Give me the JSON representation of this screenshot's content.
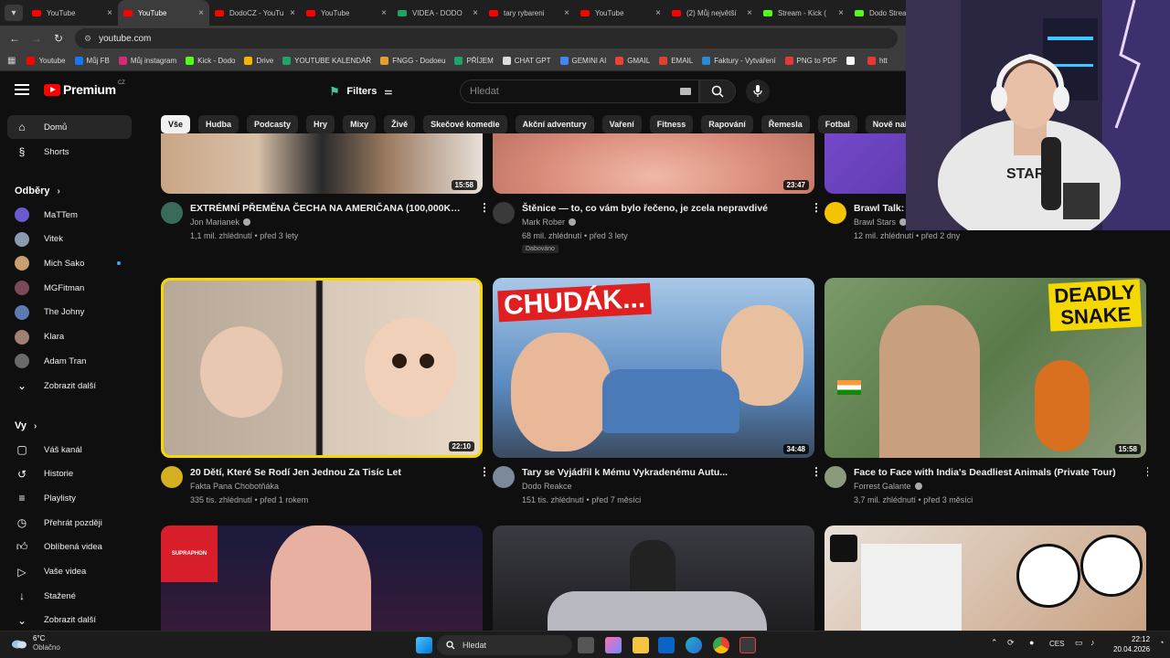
{
  "browser": {
    "tabs": [
      {
        "label": "YouTube",
        "active": false,
        "favicon_color": "#ff0000"
      },
      {
        "label": "YouTube",
        "active": true,
        "favicon_color": "#ff0000"
      },
      {
        "label": "DodoCZ - YouTu",
        "active": false,
        "favicon_color": "#ff0000"
      },
      {
        "label": "YouTube",
        "active": false,
        "favicon_color": "#ff0000"
      },
      {
        "label": "VIDEA - DODO",
        "active": false,
        "favicon_color": "#1fa463"
      },
      {
        "label": "tary rybareni",
        "active": false,
        "favicon_color": "#ff0000"
      },
      {
        "label": "YouTube",
        "active": false,
        "favicon_color": "#ff0000"
      },
      {
        "label": "(2) Můj největší",
        "active": false,
        "favicon_color": "#ff0000"
      },
      {
        "label": "Stream - Kick (",
        "active": false,
        "favicon_color": "#53fc18"
      },
      {
        "label": "Dodo Strea",
        "active": false,
        "favicon_color": "#53fc18"
      }
    ],
    "url": "youtube.com",
    "bookmarks": [
      {
        "label": "Youtube",
        "color": "#ff0000"
      },
      {
        "label": "Můj FB",
        "color": "#1877f2"
      },
      {
        "label": "Můj instagram",
        "color": "#d62976"
      },
      {
        "label": "Kick - Dodo",
        "color": "#53fc18"
      },
      {
        "label": "Drive",
        "color": "#f4b400"
      },
      {
        "label": "YOUTUBE KALENDÁŘ",
        "color": "#1fa463"
      },
      {
        "label": "FNGG - Dodoeu",
        "color": "#e0a030"
      },
      {
        "label": "PŘÍJEM",
        "color": "#1fa463"
      },
      {
        "label": "CHAT GPT",
        "color": "#dddddd"
      },
      {
        "label": "GEMINI AI",
        "color": "#4285f4"
      },
      {
        "label": "GMAIL",
        "color": "#ea4335"
      },
      {
        "label": "EMAIL",
        "color": "#e04030"
      },
      {
        "label": "Faktury - Vytváření",
        "color": "#2a8ad4"
      },
      {
        "label": "PNG to PDF",
        "color": "#e53935"
      },
      {
        "label": "",
        "color": "#ffffff"
      },
      {
        "label": "htt",
        "color": "#e53935"
      }
    ]
  },
  "header": {
    "brand": "Premium",
    "region": "CZ",
    "filters_label": "Filters",
    "search_placeholder": "Hledat"
  },
  "chips": [
    "Vše",
    "Hudba",
    "Podcasty",
    "Hry",
    "Mixy",
    "Živě",
    "Skečové komedie",
    "Akční adventury",
    "Vaření",
    "Fitness",
    "Rapování",
    "Řemesla",
    "Fotbal",
    "Nově nahráno"
  ],
  "sidebar": {
    "main": [
      {
        "label": "Domů",
        "icon": "home-icon",
        "active": true
      },
      {
        "label": "Shorts",
        "icon": "shorts-icon",
        "active": false
      }
    ],
    "subscriptions_heading": "Odběry",
    "subscriptions": [
      {
        "label": "MaTTem",
        "color": "#6a5acd",
        "live": false
      },
      {
        "label": "Vitek",
        "color": "#8a9bb0",
        "live": false
      },
      {
        "label": "Mich Sako",
        "color": "#c8a070",
        "live": true
      },
      {
        "label": "MGFitman",
        "color": "#7a4a5a",
        "live": false
      },
      {
        "label": "The Johny",
        "color": "#5a7ab0",
        "live": false
      },
      {
        "label": "Klara",
        "color": "#a08070",
        "live": false
      },
      {
        "label": "Adam Tran",
        "color": "#6a6a6a",
        "live": false
      }
    ],
    "show_more": "Zobrazit další",
    "you_heading": "Vy",
    "you_items": [
      {
        "label": "Váš kanál",
        "icon": "your-channel-icon"
      },
      {
        "label": "Historie",
        "icon": "history-icon"
      },
      {
        "label": "Playlisty",
        "icon": "playlists-icon"
      },
      {
        "label": "Přehrát později",
        "icon": "watch-later-icon"
      },
      {
        "label": "Oblíbená videa",
        "icon": "liked-videos-icon"
      },
      {
        "label": "Vaše videa",
        "icon": "your-videos-icon"
      },
      {
        "label": "Stažené",
        "icon": "downloads-icon"
      },
      {
        "label": "Zobrazit další",
        "icon": "chevron-down-icon"
      }
    ]
  },
  "videos_row1": [
    {
      "title": "EXTRÉMNÍ PŘEMĚNA ČECHA NA AMERIČANA (100,000Kč+)",
      "channel": "Jon Marianek",
      "verified": true,
      "stats": "1,1 mil. zhlédnutí • před 3 lety",
      "duration": "15:58",
      "badge": "",
      "thumb_color": "#c9a586",
      "avatar_color": "#3a6a5a"
    },
    {
      "title": "Štěnice — to, co vám bylo řečeno, je zcela nepravdivé",
      "channel": "Mark Rober",
      "verified": true,
      "stats": "68 mil. zhlédnutí • před 3 lety",
      "duration": "23:47",
      "badge": "Dabováno",
      "thumb_color": "#d98b7a",
      "avatar_color": "#3a3a3a"
    },
    {
      "title": "Brawl Talk: 3",
      "channel": "Brawl Stars",
      "verified": true,
      "stats": "12 mil. zhlédnutí • před 2 dny",
      "duration": "",
      "badge": "",
      "thumb_color": "#5a3aa0",
      "avatar_color": "#f5c400"
    }
  ],
  "videos_row2": [
    {
      "title": "20 Dětí, Které Se Rodí Jen Jednou Za Tisíc Let",
      "channel": "Fakta Pana Chobotňáka",
      "verified": false,
      "stats": "335 tis. zhlédnutí • před 1 rokem",
      "duration": "22:10",
      "badge": "",
      "thumb_color": "#b8a898",
      "avatar_color": "#d4b020"
    },
    {
      "title": "Tary se Vyjádřil k Mému Vykradenému Autu...",
      "channel": "Dodo Reakce",
      "verified": false,
      "stats": "151 tis. zhlédnutí • před 7 měsíci",
      "duration": "34:48",
      "badge": "",
      "thumb_color": "#6a8ab0",
      "avatar_color": "#7a8a9a"
    },
    {
      "title": "Face to Face with India's Deadliest Animals (Private Tour)",
      "channel": "Forrest Galante",
      "verified": true,
      "stats": "3,7 mil. zhlédnutí • před 3 měsíci",
      "duration": "15:58",
      "badge": "",
      "thumb_color": "#6a8a5a",
      "avatar_color": "#8a9a7a"
    }
  ],
  "videos_row3": [
    {
      "thumb_color": "#2a1a28"
    },
    {
      "thumb_color": "#2a2a2e"
    },
    {
      "thumb_color": "#e8e0d8"
    }
  ],
  "thumb_text": {
    "chudak": "CHUDÁK...",
    "deadly": "DEADLY",
    "snake": "SNAKE",
    "supraphon": "SUPRAPHON"
  },
  "taskbar": {
    "temperature": "6°C",
    "weather": "Oblačno",
    "search_placeholder": "Hledat",
    "language": "CES",
    "time": "22:12",
    "date": "20.04.2026"
  },
  "colors": {
    "accent_red": "#ff0000",
    "background": "#0f0f0f",
    "chip_bg": "#272727"
  }
}
